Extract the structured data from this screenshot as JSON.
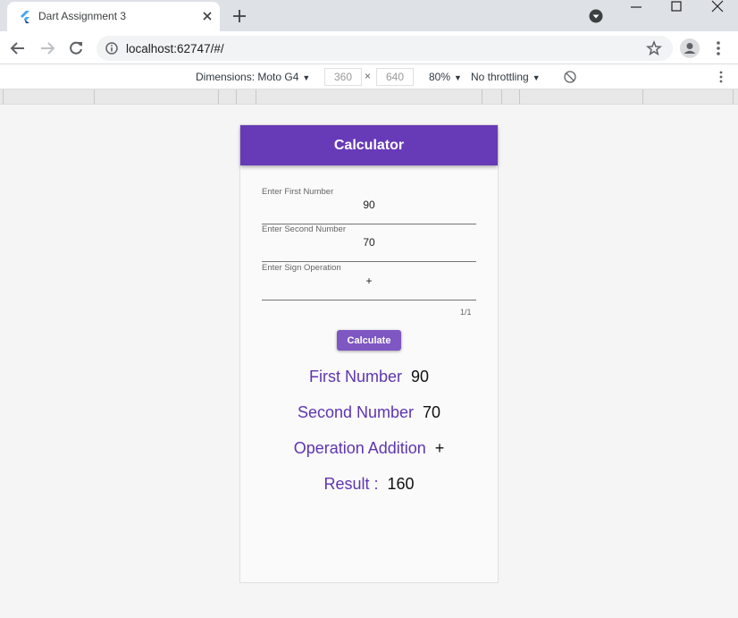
{
  "browser": {
    "tab_title": "Dart Assignment 3",
    "url": "localhost:62747/#/"
  },
  "devtools": {
    "device_label": "Dimensions: Moto G4",
    "width": "360",
    "times": "×",
    "height": "640",
    "zoom": "80%",
    "throttling": "No throttling"
  },
  "app": {
    "title": "Calculator",
    "fields": [
      {
        "label": "Enter First Number",
        "value": "90"
      },
      {
        "label": "Enter Second Number",
        "value": "70"
      },
      {
        "label": "Enter Sign Operation",
        "value": "+"
      }
    ],
    "counter": "1/1",
    "button_label": "Calculate",
    "results": [
      {
        "label": "First Number",
        "value": "90"
      },
      {
        "label": "Second Number",
        "value": "70"
      },
      {
        "label": "Operation Addition",
        "value": "+"
      },
      {
        "label": "Result :",
        "value": "160"
      }
    ]
  },
  "colors": {
    "appbar": "#673ab7",
    "button": "#7e57c2",
    "result_label": "#5e35b1"
  }
}
